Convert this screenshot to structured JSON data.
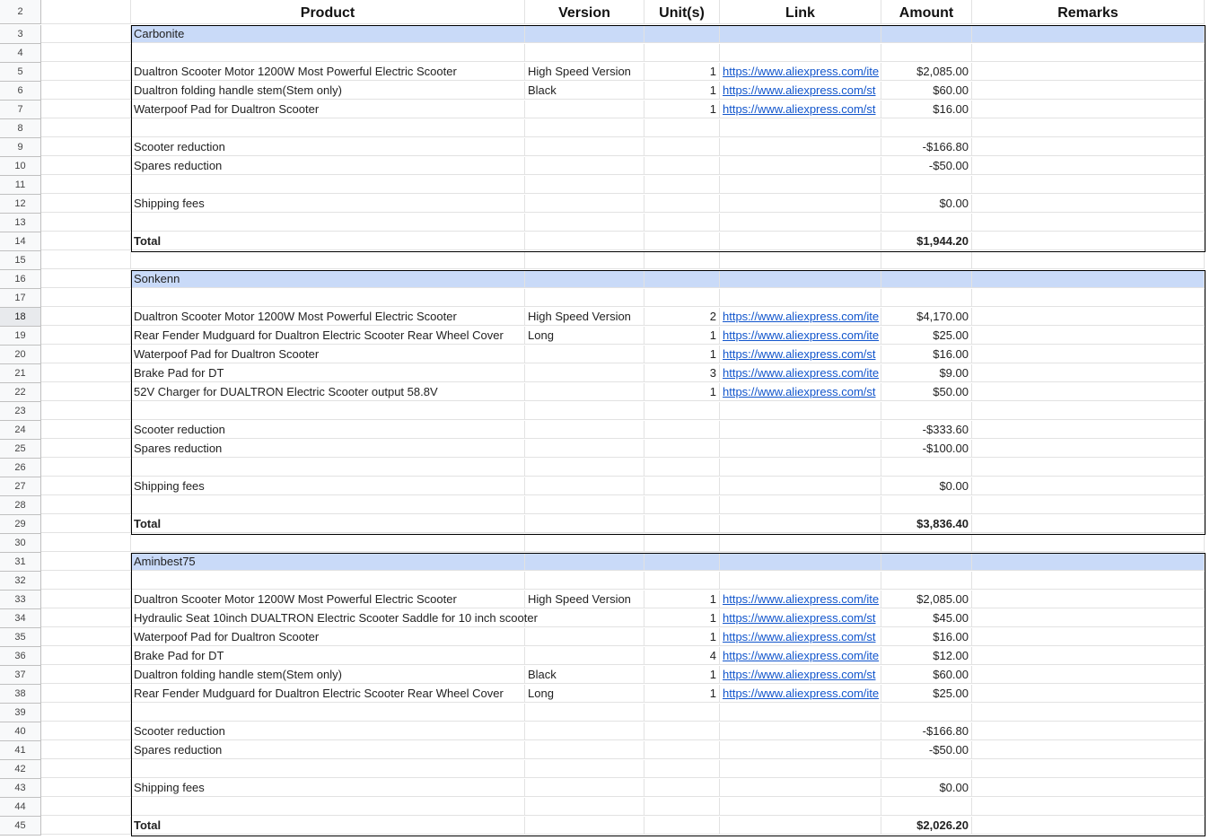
{
  "header": {
    "row_number": "2",
    "product": "Product",
    "version": "Version",
    "units": "Unit(s)",
    "link": "Link",
    "amount": "Amount",
    "remarks": "Remarks"
  },
  "selected_row": "18",
  "rows": [
    {
      "n": "3",
      "type": "group",
      "product": "Carbonite"
    },
    {
      "n": "4",
      "type": "blank"
    },
    {
      "n": "5",
      "type": "item",
      "product": "Dualtron Scooter Motor 1200W Most Powerful Electric Scooter",
      "version": "High Speed Version",
      "units": "1",
      "link": "https://www.aliexpress.com/ite",
      "amount": "$2,085.00"
    },
    {
      "n": "6",
      "type": "item",
      "product": "Dualtron folding handle stem(Stem only)",
      "version": "Black",
      "units": "1",
      "link": "https://www.aliexpress.com/st",
      "amount": "$60.00"
    },
    {
      "n": "7",
      "type": "item",
      "product": "Waterpoof Pad for Dualtron Scooter",
      "version": "",
      "units": "1",
      "link": "https://www.aliexpress.com/st",
      "amount": "$16.00"
    },
    {
      "n": "8",
      "type": "blank"
    },
    {
      "n": "9",
      "type": "summary",
      "product": "Scooter reduction",
      "amount": "-$166.80"
    },
    {
      "n": "10",
      "type": "summary",
      "product": "Spares reduction",
      "amount": "-$50.00"
    },
    {
      "n": "11",
      "type": "blank"
    },
    {
      "n": "12",
      "type": "summary",
      "product": "Shipping fees",
      "amount": "$0.00"
    },
    {
      "n": "13",
      "type": "blank"
    },
    {
      "n": "14",
      "type": "total",
      "product": "Total",
      "amount": "$1,944.20"
    },
    {
      "n": "15",
      "type": "gap"
    },
    {
      "n": "16",
      "type": "group",
      "product": "Sonkenn"
    },
    {
      "n": "17",
      "type": "blank"
    },
    {
      "n": "18",
      "type": "item",
      "product": "Dualtron Scooter Motor 1200W Most Powerful Electric Scooter",
      "version": "High Speed Version",
      "units": "2",
      "link": "https://www.aliexpress.com/ite",
      "amount": "$4,170.00"
    },
    {
      "n": "19",
      "type": "item",
      "product": "Rear Fender Mudguard for Dualtron Electric Scooter Rear Wheel Cover",
      "version": "Long",
      "units": "1",
      "link": "https://www.aliexpress.com/ite",
      "amount": "$25.00"
    },
    {
      "n": "20",
      "type": "item",
      "product": "Waterpoof Pad for Dualtron Scooter",
      "version": "",
      "units": "1",
      "link": "https://www.aliexpress.com/st",
      "amount": "$16.00"
    },
    {
      "n": "21",
      "type": "item",
      "product": "Brake Pad for DT",
      "version": "",
      "units": "3",
      "link": "https://www.aliexpress.com/ite",
      "amount": "$9.00"
    },
    {
      "n": "22",
      "type": "item",
      "product": "52V Charger for DUALTRON Electric Scooter output 58.8V",
      "version": "",
      "units": "1",
      "link": "https://www.aliexpress.com/st",
      "amount": "$50.00"
    },
    {
      "n": "23",
      "type": "blank"
    },
    {
      "n": "24",
      "type": "summary",
      "product": "Scooter reduction",
      "amount": "-$333.60"
    },
    {
      "n": "25",
      "type": "summary",
      "product": "Spares reduction",
      "amount": "-$100.00"
    },
    {
      "n": "26",
      "type": "blank"
    },
    {
      "n": "27",
      "type": "summary",
      "product": "Shipping fees",
      "amount": "$0.00"
    },
    {
      "n": "28",
      "type": "blank"
    },
    {
      "n": "29",
      "type": "total",
      "product": "Total",
      "amount": "$3,836.40"
    },
    {
      "n": "30",
      "type": "gap"
    },
    {
      "n": "31",
      "type": "group",
      "product": "Aminbest75"
    },
    {
      "n": "32",
      "type": "blank"
    },
    {
      "n": "33",
      "type": "item",
      "product": "Dualtron Scooter Motor 1200W Most Powerful Electric Scooter",
      "version": "High Speed Version",
      "units": "1",
      "link": "https://www.aliexpress.com/ite",
      "amount": "$2,085.00"
    },
    {
      "n": "34",
      "type": "item",
      "product": "Hydraulic Seat 10inch DUALTRON Electric Scooter Saddle for 10 inch scooter",
      "version": "",
      "units": "1",
      "link": "https://www.aliexpress.com/st",
      "amount": "$45.00"
    },
    {
      "n": "35",
      "type": "item",
      "product": "Waterpoof Pad for Dualtron Scooter",
      "version": "",
      "units": "1",
      "link": "https://www.aliexpress.com/st",
      "amount": "$16.00"
    },
    {
      "n": "36",
      "type": "item",
      "product": "Brake Pad for DT",
      "version": "",
      "units": "4",
      "link": "https://www.aliexpress.com/ite",
      "amount": "$12.00"
    },
    {
      "n": "37",
      "type": "item",
      "product": "Dualtron folding handle stem(Stem only)",
      "version": "Black",
      "units": "1",
      "link": "https://www.aliexpress.com/st",
      "amount": "$60.00"
    },
    {
      "n": "38",
      "type": "item",
      "product": "Rear Fender Mudguard for Dualtron Electric Scooter Rear Wheel Cover",
      "version": "Long",
      "units": "1",
      "link": "https://www.aliexpress.com/ite",
      "amount": "$25.00"
    },
    {
      "n": "39",
      "type": "blank"
    },
    {
      "n": "40",
      "type": "summary",
      "product": "Scooter reduction",
      "amount": "-$166.80"
    },
    {
      "n": "41",
      "type": "summary",
      "product": "Spares reduction",
      "amount": "-$50.00"
    },
    {
      "n": "42",
      "type": "blank"
    },
    {
      "n": "43",
      "type": "summary",
      "product": "Shipping fees",
      "amount": "$0.00"
    },
    {
      "n": "44",
      "type": "blank"
    },
    {
      "n": "45",
      "type": "total",
      "product": "Total",
      "amount": "$2,026.20"
    }
  ]
}
